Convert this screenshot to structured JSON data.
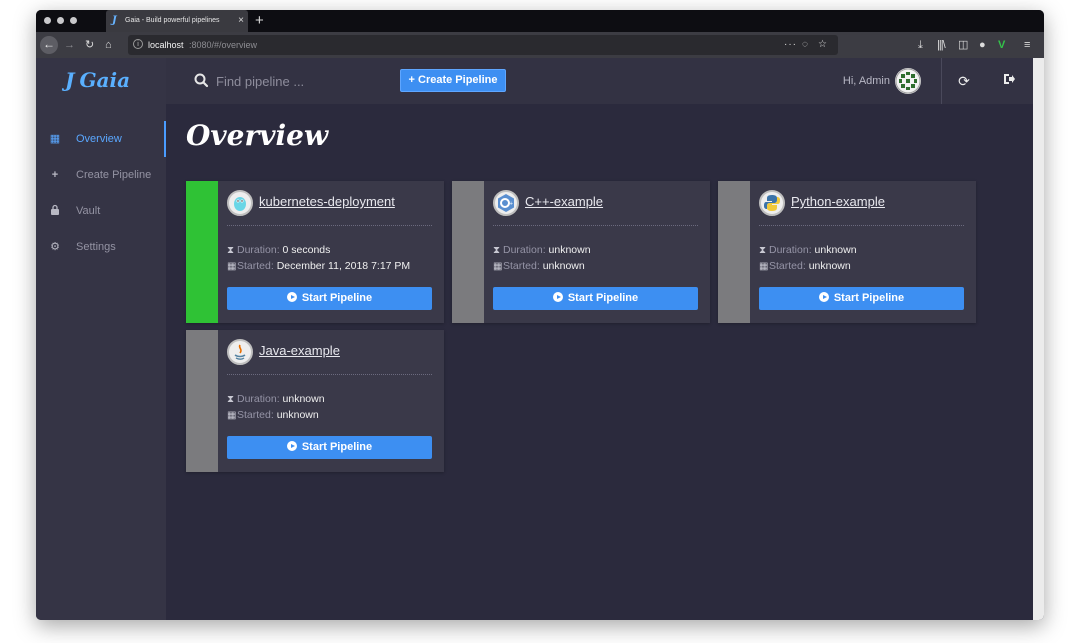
{
  "browser": {
    "tab_title": "Gaia - Build powerful pipelines",
    "url_host": "localhost",
    "url_path": ":8080/#/overview"
  },
  "app": {
    "logo_mark": "J",
    "logo_text": "Gaia"
  },
  "sidebar": {
    "items": [
      {
        "label": "Overview",
        "icon": "grid-icon",
        "active": true
      },
      {
        "label": "Create Pipeline",
        "icon": "plus-icon",
        "active": false
      },
      {
        "label": "Vault",
        "icon": "lock-icon",
        "active": false
      },
      {
        "label": "Settings",
        "icon": "gears-icon",
        "active": false
      }
    ]
  },
  "topbar": {
    "search_placeholder": "Find pipeline ...",
    "create_label": "Create Pipeline",
    "greeting": "Hi, Admin"
  },
  "main": {
    "title": "Overview",
    "duration_label": "Duration:",
    "started_label": "Started:",
    "start_label": "Start Pipeline",
    "pipelines": [
      {
        "name": "kubernetes-deployment",
        "duration": "0 seconds",
        "started": "December 11, 2018 7:17 PM",
        "status_color": "#2fc235",
        "icon": "kubernetes-gopher-icon"
      },
      {
        "name": "C++-example",
        "duration": "unknown",
        "started": "unknown",
        "status_color": "#7b7b7e",
        "icon": "cpp-icon"
      },
      {
        "name": "Python-example",
        "duration": "unknown",
        "started": "unknown",
        "status_color": "#7b7b7e",
        "icon": "python-icon"
      },
      {
        "name": "Java-example",
        "duration": "unknown",
        "started": "unknown",
        "status_color": "#7b7b7e",
        "icon": "java-icon"
      }
    ]
  },
  "colors": {
    "accent": "#3d8ff2",
    "sidebar_bg": "#353445",
    "main_bg": "#2b2a3d",
    "card_bg": "#3a3949",
    "success": "#2fc235",
    "neutral": "#7b7b7e"
  }
}
